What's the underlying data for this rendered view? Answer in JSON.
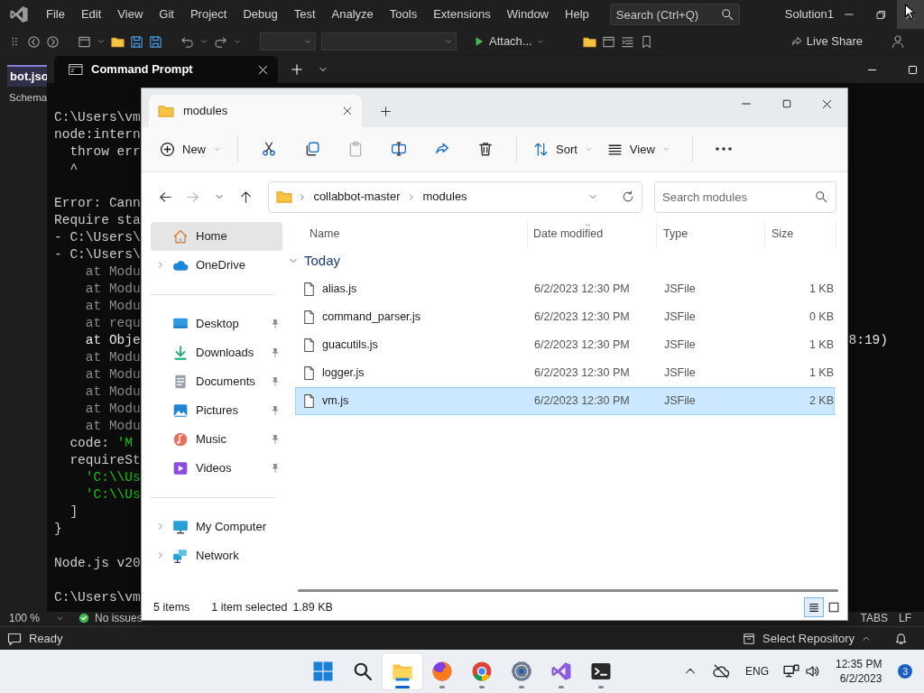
{
  "ide": {
    "menu": [
      "File",
      "Edit",
      "View",
      "Git",
      "Project",
      "Debug",
      "Test",
      "Analyze",
      "Tools",
      "Extensions",
      "Window",
      "Help"
    ],
    "search": {
      "placeholder": "Search (Ctrl+Q)"
    },
    "solution": "Solution1",
    "toolbar": {
      "attach": "Attach...",
      "live_share": "Live Share"
    },
    "editor_tab": "bot.jso",
    "schema": "Schema",
    "zoom": "100 %",
    "issues": "No issues",
    "indent": "TABS",
    "line_ending": "LF",
    "status": "Ready",
    "repository": "Select Repository"
  },
  "terminal": {
    "title": "Command Prompt",
    "lines": [
      {
        "kind": "normal",
        "text": "C:\\Users\\vm"
      },
      {
        "kind": "normal",
        "text": "node:intern"
      },
      {
        "kind": "normal",
        "text": "  throw err"
      },
      {
        "kind": "normal",
        "text": "  ^"
      },
      {
        "kind": "blank"
      },
      {
        "kind": "normal",
        "text": "Error: Cann"
      },
      {
        "kind": "normal",
        "text": "Require sta"
      },
      {
        "kind": "normal",
        "text": "- C:\\Users\\"
      },
      {
        "kind": "normal",
        "text": "- C:\\Users\\"
      },
      {
        "kind": "dim",
        "text": "    at Modu"
      },
      {
        "kind": "dim",
        "text": "    at Modu"
      },
      {
        "kind": "dim",
        "text": "    at Modu"
      },
      {
        "kind": "dim",
        "text": "    at requ"
      },
      {
        "kind": "bright",
        "text": "    at Obje",
        "tail": "8:19)"
      },
      {
        "kind": "dim",
        "text": "    at Modu"
      },
      {
        "kind": "dim",
        "text": "    at Modu"
      },
      {
        "kind": "dim",
        "text": "    at Modu"
      },
      {
        "kind": "dim",
        "text": "    at Modu"
      },
      {
        "kind": "dim",
        "text": "    at Modu"
      },
      {
        "kind": "normal",
        "text": "  code: ",
        "value": "'M"
      },
      {
        "kind": "normal",
        "text": "  requireSt"
      },
      {
        "kind": "green",
        "text": "    'C:\\\\Us"
      },
      {
        "kind": "green",
        "text": "    'C:\\\\Us"
      },
      {
        "kind": "normal",
        "text": "  ]"
      },
      {
        "kind": "normal",
        "text": "}"
      },
      {
        "kind": "blank"
      },
      {
        "kind": "normal",
        "text": "Node.js v20"
      },
      {
        "kind": "blank"
      },
      {
        "kind": "normal",
        "text": "C:\\Users\\vm"
      }
    ]
  },
  "explorer": {
    "tab": "modules",
    "commands": [
      [
        {
          "kind": "new",
          "label": "New",
          "menu": true,
          "disabled": false
        }
      ],
      [
        {
          "kind": "cut",
          "menu": false,
          "disabled": false
        },
        {
          "kind": "copy",
          "menu": false,
          "disabled": false
        },
        {
          "kind": "paste",
          "menu": false,
          "disabled": true
        },
        {
          "kind": "rename",
          "menu": false,
          "disabled": false
        },
        {
          "kind": "share",
          "menu": false,
          "disabled": false
        },
        {
          "kind": "delete",
          "menu": false,
          "disabled": false
        }
      ],
      [
        {
          "kind": "sort",
          "label": "Sort",
          "menu": true,
          "disabled": false
        },
        {
          "kind": "view",
          "label": "View",
          "menu": true,
          "disabled": false
        }
      ],
      [
        {
          "kind": "more",
          "menu": false,
          "disabled": false
        }
      ]
    ],
    "nav_buttons": [
      {
        "kind": "back",
        "disabled": false
      },
      {
        "kind": "forward",
        "disabled": true
      },
      {
        "kind": "recent",
        "disabled": false
      },
      {
        "kind": "up",
        "disabled": false
      }
    ],
    "breadcrumb": [
      "collabbot-master",
      "modules"
    ],
    "search": {
      "placeholder": "Search modules"
    },
    "navigation": [
      [
        {
          "label": "Home",
          "kind": "home",
          "selected": true,
          "expandable": false,
          "pinned": false
        },
        {
          "label": "OneDrive",
          "kind": "cloud",
          "selected": false,
          "expandable": true,
          "pinned": false
        }
      ],
      [
        {
          "label": "Desktop",
          "kind": "desktop",
          "selected": false,
          "expandable": false,
          "pinned": true
        },
        {
          "label": "Downloads",
          "kind": "download",
          "selected": false,
          "expandable": false,
          "pinned": true
        },
        {
          "label": "Documents",
          "kind": "document",
          "selected": false,
          "expandable": false,
          "pinned": true
        },
        {
          "label": "Pictures",
          "kind": "picture",
          "selected": false,
          "expandable": false,
          "pinned": true
        },
        {
          "label": "Music",
          "kind": "music",
          "selected": false,
          "expandable": false,
          "pinned": true
        },
        {
          "label": "Videos",
          "kind": "video",
          "selected": false,
          "expandable": false,
          "pinned": true
        }
      ],
      [
        {
          "label": "My Computer",
          "kind": "computer",
          "selected": false,
          "expandable": true,
          "pinned": false
        },
        {
          "label": "Network",
          "kind": "network",
          "selected": false,
          "expandable": true,
          "pinned": false
        }
      ]
    ],
    "columns": [
      {
        "label": "Name",
        "sorted": false
      },
      {
        "label": "Date modified",
        "sorted": true
      },
      {
        "label": "Type",
        "sorted": false
      },
      {
        "label": "Size",
        "sorted": false
      }
    ],
    "group": {
      "label": "Today",
      "expanded": true
    },
    "rows": [
      {
        "name": "alias.js",
        "date": "6/2/2023 12:30 PM",
        "type": "JSFile",
        "size": "1 KB",
        "selected": false
      },
      {
        "name": "command_parser.js",
        "date": "6/2/2023 12:30 PM",
        "type": "JSFile",
        "size": "0 KB",
        "selected": false
      },
      {
        "name": "guacutils.js",
        "date": "6/2/2023 12:30 PM",
        "type": "JSFile",
        "size": "1 KB",
        "selected": false
      },
      {
        "name": "logger.js",
        "date": "6/2/2023 12:30 PM",
        "type": "JSFile",
        "size": "1 KB",
        "selected": false
      },
      {
        "name": "vm.js",
        "date": "6/2/2023 12:30 PM",
        "type": "JSFile",
        "size": "2 KB",
        "selected": true
      }
    ],
    "status": {
      "count": "5 items",
      "selection": "1 item selected",
      "size": "1.89 KB"
    },
    "views": [
      {
        "kind": "details",
        "selected": true
      },
      {
        "kind": "tiles",
        "selected": false
      }
    ]
  },
  "taskbar": {
    "apps": [
      {
        "kind": "start",
        "active": false,
        "running": false
      },
      {
        "kind": "search",
        "active": false,
        "running": false
      },
      {
        "kind": "files",
        "active": true,
        "running": true
      },
      {
        "kind": "firefox",
        "active": false,
        "running": true
      },
      {
        "kind": "chrome",
        "active": false,
        "running": true
      },
      {
        "kind": "settings",
        "active": false,
        "running": true
      },
      {
        "kind": "studio",
        "active": false,
        "running": true
      },
      {
        "kind": "terminal",
        "active": false,
        "running": true
      }
    ],
    "language": "ENG",
    "time": "12:35 PM",
    "date": "6/2/2023",
    "notifications": "3"
  }
}
